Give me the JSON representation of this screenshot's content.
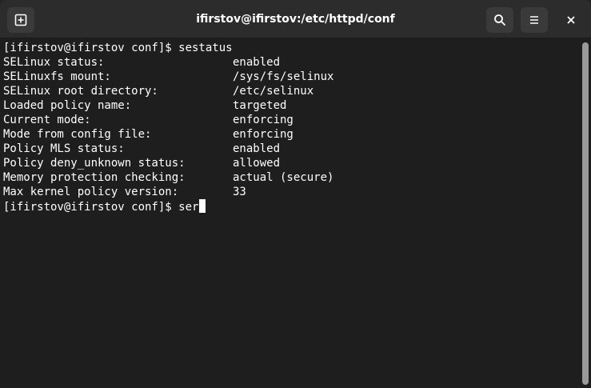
{
  "window": {
    "title": "ifirstov@ifirstov:/etc/httpd/conf"
  },
  "toolbar": {
    "icons": [
      "new-tab-icon",
      "search-icon",
      "hamburger-menu-icon",
      "close-icon"
    ]
  },
  "terminal": {
    "command_line": "[ifirstov@ifirstov conf]$ sestatus",
    "output": [
      {
        "key": "SELinux status:",
        "value": "enabled"
      },
      {
        "key": "SELinuxfs mount:",
        "value": "/sys/fs/selinux"
      },
      {
        "key": "SELinux root directory:",
        "value": "/etc/selinux"
      },
      {
        "key": "Loaded policy name:",
        "value": "targeted"
      },
      {
        "key": "Current mode:",
        "value": "enforcing"
      },
      {
        "key": "Mode from config file:",
        "value": "enforcing"
      },
      {
        "key": "Policy MLS status:",
        "value": "enabled"
      },
      {
        "key": "Policy deny_unknown status:",
        "value": "allowed"
      },
      {
        "key": "Memory protection checking:",
        "value": "actual (secure)"
      },
      {
        "key": "Max kernel policy version:",
        "value": "33"
      }
    ],
    "prompt_line": "[ifirstov@ifirstov conf]$ ser"
  },
  "colors": {
    "background": "#1e1e1e",
    "titlebar": "#2c2c2c",
    "text": "#ffffff"
  }
}
